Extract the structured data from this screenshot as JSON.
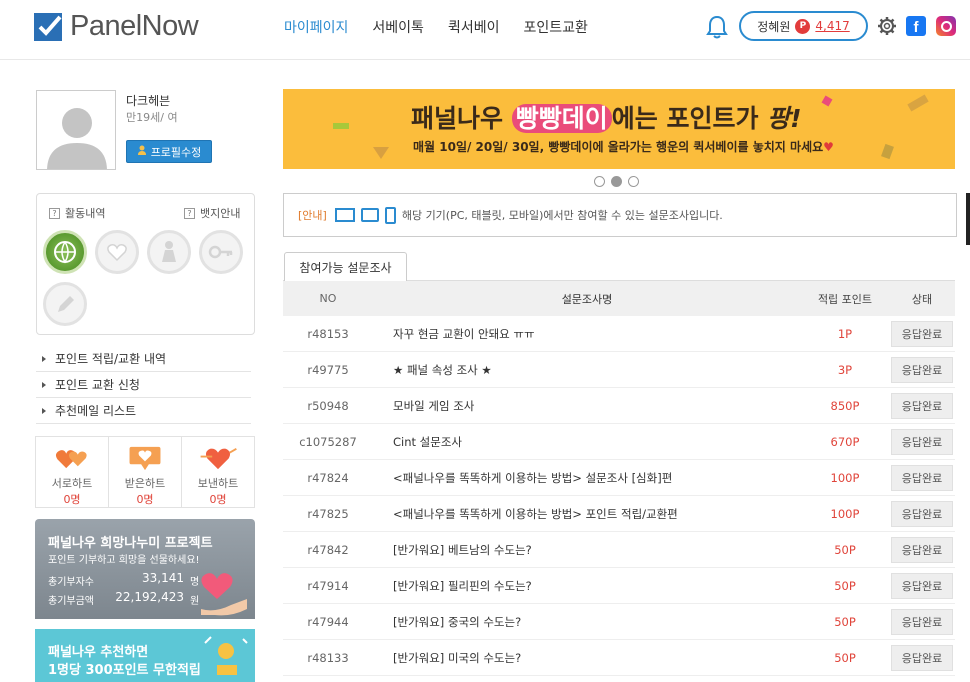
{
  "header": {
    "logo_text": "PanelNow",
    "nav": [
      "마이페이지",
      "서베이톡",
      "퀵서베이",
      "포인트교환"
    ],
    "user_name": "정혜원",
    "point_badge": "P",
    "points": "4,417"
  },
  "profile": {
    "name": "다크헤븐",
    "age": "만19세/ 여",
    "edit_label": "프로필수정"
  },
  "badges": {
    "activity_label": "활동내역",
    "activity_icon": "?",
    "guide_label": "뱃지안내",
    "guide_icon": "?"
  },
  "menu": [
    "포인트 적립/교환 내역",
    "포인트 교환 신청",
    "추천메일 리스트"
  ],
  "hearts": [
    {
      "label": "서로하트",
      "value": "0명"
    },
    {
      "label": "받은하트",
      "value": "0명"
    },
    {
      "label": "보낸하트",
      "value": "0명"
    }
  ],
  "hope": {
    "title": "패널나우 희망나누미 프로젝트",
    "subtitle": "포인트 기부하고 희망을 선물하세요!",
    "donors_label": "총기부자수",
    "donors_value": "33,141",
    "donors_unit": "명",
    "amount_label": "총기부금액",
    "amount_value": "22,192,423",
    "amount_unit": "원"
  },
  "recommend": {
    "line1": "패널나우 추천하면",
    "line2": "1명당 300포인트 무한적립"
  },
  "banner": {
    "pre": "패널나우 ",
    "highlight": "빵빵데이",
    "mid": "에는 포인트가 ",
    "emph": "팡!",
    "sub": "매월 10일/ 20일/ 30일, 빵빵데이에 올라가는 행운의 퀵서베이를 놓치지 마세요",
    "heart": "♥"
  },
  "notice": {
    "tag": "[안내]",
    "text": "해당 기기(PC, 태블릿, 모바일)에서만 참여할 수 있는 설문조사입니다."
  },
  "tab_label": "참여가능 설문조사",
  "table": {
    "headers": {
      "no": "NO",
      "title": "설문조사명",
      "points": "적립 포인트",
      "status": "상태"
    },
    "rows": [
      {
        "no": "r48153",
        "title": "자꾸 현금 교환이 안돼요 ㅠㅠ",
        "points": "1P",
        "status": "응답완료"
      },
      {
        "no": "r49775",
        "title": "★ 패널 속성 조사 ★",
        "points": "3P",
        "status": "응답완료"
      },
      {
        "no": "r50948",
        "title": "모바일 게임 조사",
        "points": "850P",
        "status": "응답완료"
      },
      {
        "no": "c1075287",
        "title": "Cint 설문조사",
        "points": "670P",
        "status": "응답완료"
      },
      {
        "no": "r47824",
        "title": "<패널나우를 똑똑하게 이용하는 방법> 설문조사 [심화]편",
        "points": "100P",
        "status": "응답완료"
      },
      {
        "no": "r47825",
        "title": "<패널나우를 똑똑하게 이용하는 방법> 포인트 적립/교환편",
        "points": "100P",
        "status": "응답완료"
      },
      {
        "no": "r47842",
        "title": "[반가워요] 베트남의 수도는?",
        "points": "50P",
        "status": "응답완료"
      },
      {
        "no": "r47914",
        "title": "[반가워요] 필리핀의 수도는?",
        "points": "50P",
        "status": "응답완료"
      },
      {
        "no": "r47944",
        "title": "[반가워요] 중국의 수도는?",
        "points": "50P",
        "status": "응답완료"
      },
      {
        "no": "r48133",
        "title": "[반가워요] 미국의 수도는?",
        "points": "50P",
        "status": "응답완료"
      }
    ]
  }
}
